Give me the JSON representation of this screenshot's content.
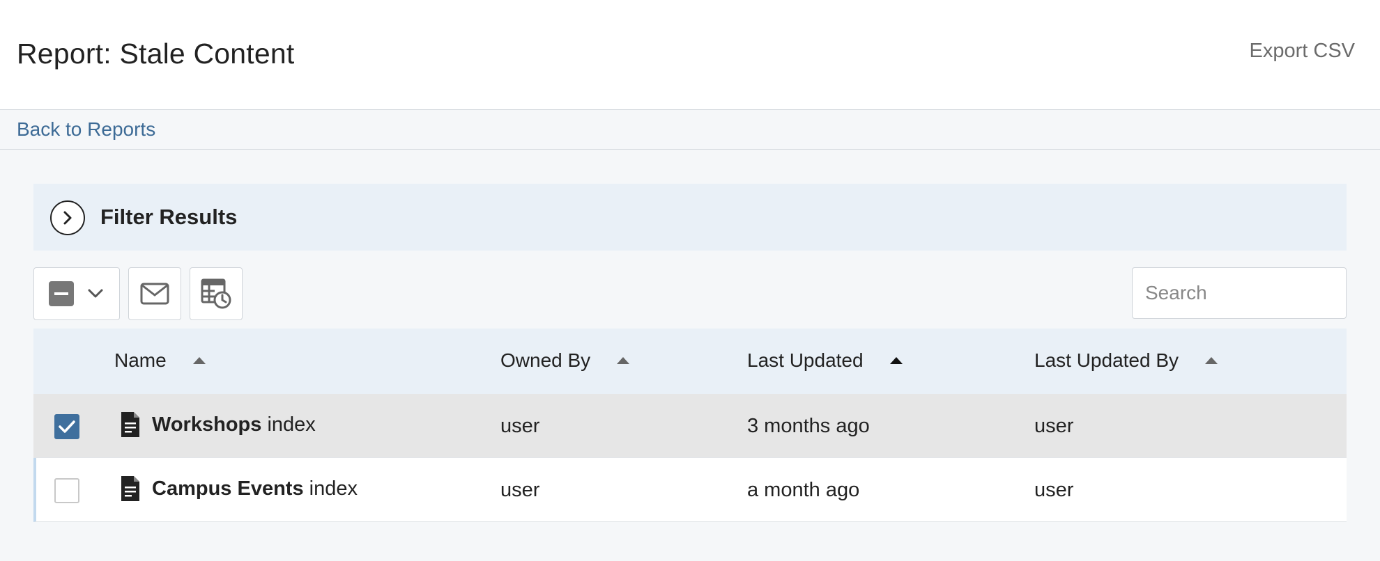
{
  "header": {
    "title": "Report: Stale Content",
    "export_label": "Export CSV"
  },
  "subnav": {
    "back_label": "Back to Reports"
  },
  "filter": {
    "label": "Filter Results"
  },
  "toolbar": {
    "select_icon": "minus-checkbox-icon",
    "email_icon": "envelope-icon",
    "schedule_icon": "schedule-table-icon"
  },
  "search": {
    "placeholder": "Search",
    "value": ""
  },
  "table": {
    "columns": [
      {
        "label": "Name",
        "sort": "asc"
      },
      {
        "label": "Owned By",
        "sort": "asc"
      },
      {
        "label": "Last Updated",
        "sort": "asc-active"
      },
      {
        "label": "Last Updated By",
        "sort": "asc"
      }
    ],
    "rows": [
      {
        "checked": true,
        "name_bold": "Workshops",
        "name_rest": " index",
        "owned_by": "user",
        "last_updated": "3 months ago",
        "last_updated_by": "user"
      },
      {
        "checked": false,
        "name_bold": "Campus Events",
        "name_rest": " index",
        "owned_by": "user",
        "last_updated": "a month ago",
        "last_updated_by": "user"
      }
    ]
  },
  "colors": {
    "accent": "#3f6f9d",
    "link": "#3d6b96",
    "panel": "#e9f0f7"
  }
}
